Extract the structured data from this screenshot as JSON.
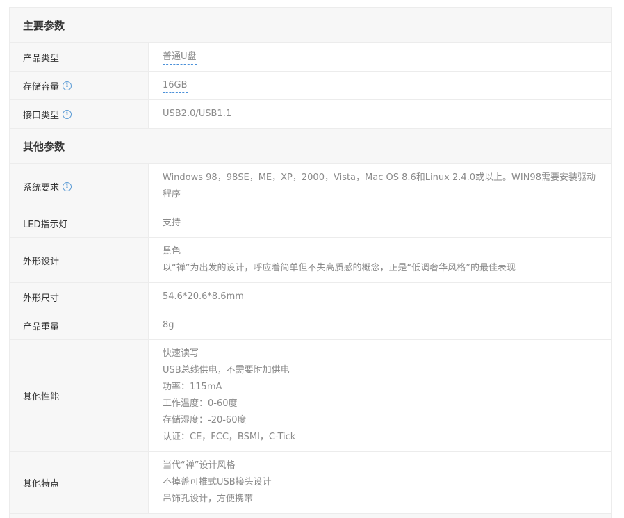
{
  "sections": {
    "main": {
      "title": "主要参数",
      "rows": {
        "product_type": {
          "label": "产品类型",
          "value": "普通U盘"
        },
        "capacity": {
          "label": "存储容量",
          "value": "16GB"
        },
        "interface": {
          "label": "接口类型",
          "value": "USB2.0/USB1.1"
        }
      }
    },
    "other": {
      "title": "其他参数",
      "rows": {
        "system": {
          "label": "系统要求",
          "value": "Windows 98，98SE，ME，XP，2000，Vista，Mac OS 8.6和Linux 2.4.0或以上。WIN98需要安装驱动程序"
        },
        "led": {
          "label": "LED指示灯",
          "value": "支持"
        },
        "design": {
          "label": "外形设计",
          "lines": [
            "黑色",
            "以“禅”为出发的设计，呼应着简单但不失高质感的概念，正是“低调奢华风格”的最佳表现"
          ]
        },
        "size": {
          "label": "外形尺寸",
          "value": "54.6*20.6*8.6mm"
        },
        "weight": {
          "label": "产品重量",
          "value": "8g"
        },
        "performance": {
          "label": "其他性能",
          "lines": [
            "快速读写",
            "USB总线供电，不需要附加供电",
            "功率：115mA",
            "工作温度：0-60度",
            "存储湿度：-20-60度",
            "认证：CE，FCC，BSMI，C-Tick"
          ]
        },
        "features": {
          "label": "其他特点",
          "lines": [
            "当代“禅”设计风格",
            "不掉盖可推式USB接头设计",
            "吊饰孔设计，方便携带"
          ]
        }
      }
    }
  },
  "icons": {
    "info": "info-circle-icon",
    "info_glyph": "i"
  },
  "colors": {
    "link_underline": "#4a90d9",
    "info_icon": "#5b9bd5",
    "label_bg": "#f7f7f7",
    "border": "#ececec"
  }
}
